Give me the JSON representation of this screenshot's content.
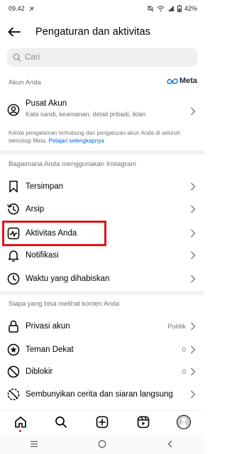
{
  "status_bar": {
    "time": "09.42",
    "battery": "42%"
  },
  "header": {
    "title": "Pengaturan dan aktivitas"
  },
  "search": {
    "placeholder": "Cari"
  },
  "account_section": {
    "label": "Akun Anda",
    "brand": "Meta",
    "item": {
      "title": "Pusat Akun",
      "subtitle": "Kata sandi, keamanan, detail pribadi, iklan"
    },
    "info_text": "Kelola pengalaman terhubung dan pengaturan akun Anda di seluruh teknologi Meta.",
    "info_link": "Pelajari selengkapnya"
  },
  "usage_section": {
    "label": "Bagaimana Anda menggunakan Instagram",
    "items": [
      {
        "label": "Tersimpan",
        "icon": "bookmark-icon"
      },
      {
        "label": "Arsip",
        "icon": "archive-icon"
      },
      {
        "label": "Aktivitas Anda",
        "icon": "activity-icon"
      },
      {
        "label": "Notifikasi",
        "icon": "bell-icon"
      },
      {
        "label": "Waktu yang dihabiskan",
        "icon": "clock-icon"
      }
    ]
  },
  "visibility_section": {
    "label": "Siapa yang bisa melihat konten Anda",
    "items": [
      {
        "label": "Privasi akun",
        "value": "Publik",
        "icon": "lock-icon"
      },
      {
        "label": "Teman Dekat",
        "value": "0",
        "icon": "star-icon"
      },
      {
        "label": "Diblokir",
        "value": "0",
        "icon": "block-icon"
      },
      {
        "label": "Sembunyikan cerita dan siaran langsung",
        "value": "",
        "icon": "hide-story-icon"
      }
    ]
  },
  "highlight_color": "#e0141c",
  "accent_color": "#0064e0",
  "tabbar": [
    "home-icon",
    "search-icon",
    "create-icon",
    "reels-icon",
    "profile-avatar"
  ],
  "android_nav": [
    "recents-icon",
    "home-circle-icon",
    "back-icon"
  ]
}
